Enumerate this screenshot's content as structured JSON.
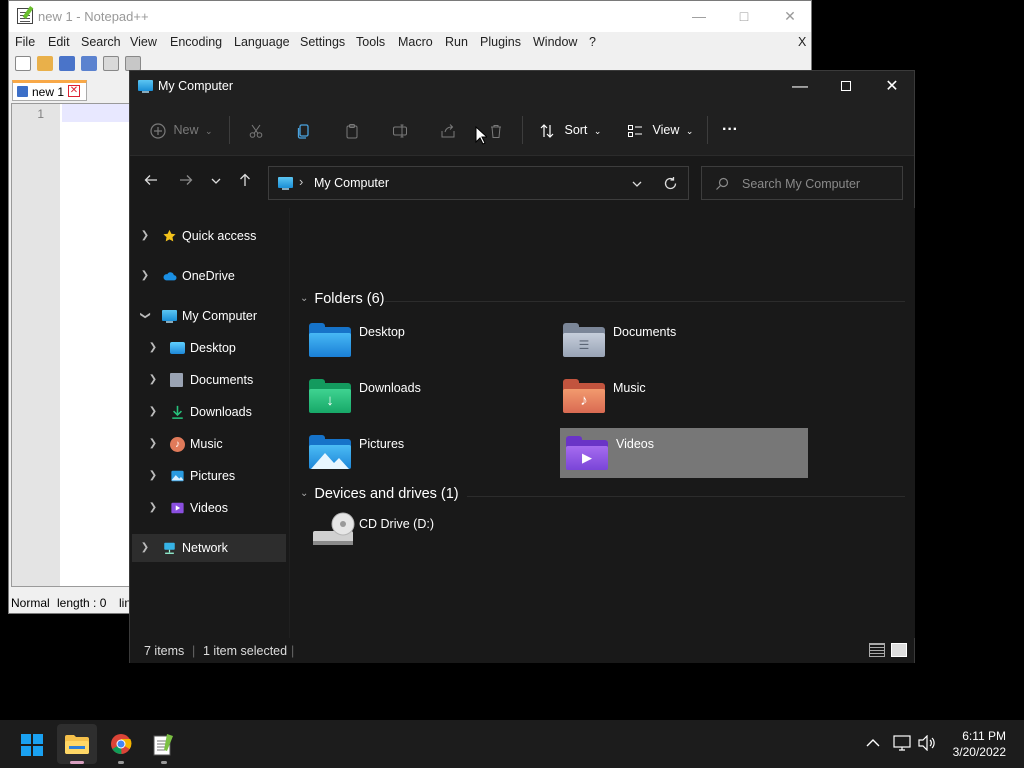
{
  "notepad": {
    "title": "new 1 - Notepad++",
    "close_x": "X",
    "menu": [
      "File",
      "Edit",
      "Search",
      "View",
      "Encoding",
      "Language",
      "Settings",
      "Tools",
      "Macro",
      "Run",
      "Plugins",
      "Window",
      "?"
    ],
    "tab_label": "new 1",
    "line_number": "1",
    "status_mode": "Normal",
    "status_length": "length : 0",
    "status_line": "lin"
  },
  "explorer": {
    "title": "My Computer",
    "toolbar": {
      "new_label": "New",
      "sort_label": "Sort",
      "view_label": "View",
      "more_label": "···"
    },
    "address": "My Computer",
    "search_placeholder": "Search My Computer",
    "nav": {
      "quick_access": "Quick access",
      "onedrive": "OneDrive",
      "my_computer": "My Computer",
      "desktop": "Desktop",
      "documents": "Documents",
      "downloads": "Downloads",
      "music": "Music",
      "pictures": "Pictures",
      "videos": "Videos",
      "network": "Network"
    },
    "folders_header": "Folders (6)",
    "folders": [
      "Desktop",
      "Documents",
      "Downloads",
      "Music",
      "Pictures",
      "Videos"
    ],
    "devices_header": "Devices and drives (1)",
    "drive_label": "CD Drive (D:)",
    "status_items": "7 items",
    "status_selected": "1 item selected"
  },
  "taskbar": {
    "time": "6:11 PM",
    "date": "3/20/2022"
  },
  "colors": {
    "accent": "#0078d4",
    "explorer_bg": "#191919",
    "selected_tile": "#777777"
  }
}
